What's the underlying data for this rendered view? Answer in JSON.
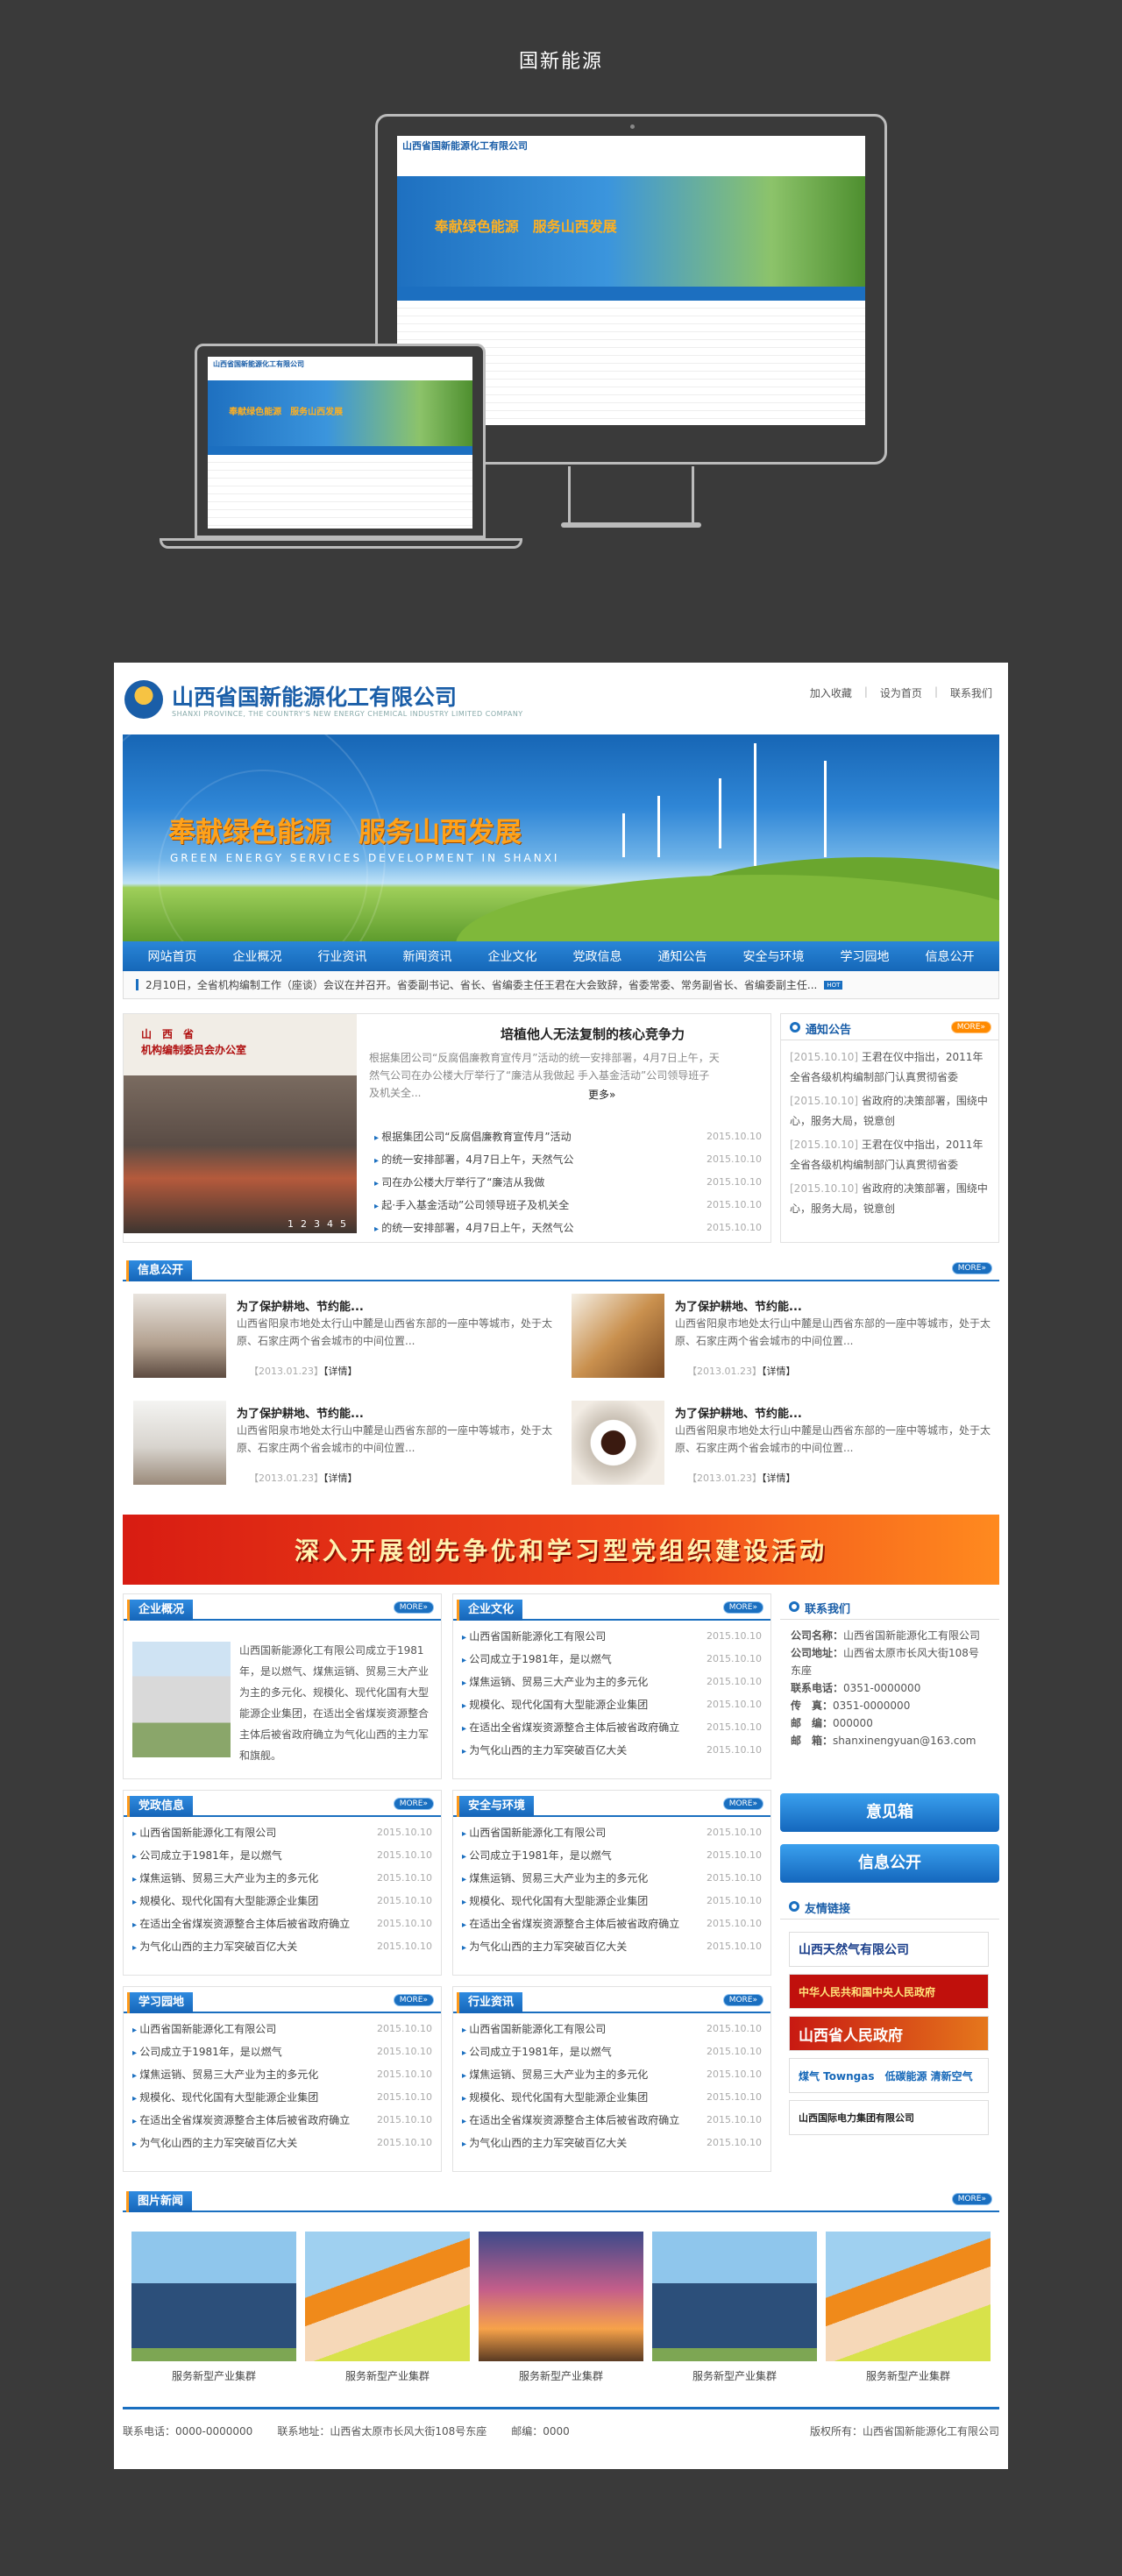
{
  "page_caption": "国新能源",
  "company": {
    "name": "山西省国新能源化工有限公司",
    "name_en": "SHANXI PROVINCE, THE COUNTRY'S NEW ENERGY CHEMICAL INDUSTRY LIMITED COMPANY"
  },
  "top_links": [
    "加入收藏",
    "设为首页",
    "联系我们"
  ],
  "banner": {
    "slogan": "奉献绿色能源　服务山西发展",
    "slogan_en": "GREEN ENERGY SERVICES DEVELOPMENT IN SHANXI"
  },
  "nav": [
    "网站首页",
    "企业概况",
    "行业资讯",
    "新闻资讯",
    "企业文化",
    "党政信息",
    "通知公告",
    "安全与环境",
    "学习园地",
    "信息公开"
  ],
  "ticker": {
    "text": "2月10日，全省机构编制工作（座谈）会议在并召开。省委副书记、省长、省编委主任王君在大会致辞，省委常委、常务副省长、省编委副主任...",
    "hot": "HOT"
  },
  "featured": {
    "title": "培植他人无法复制的核心竞争力",
    "desc": "根据集团公司“反腐倡廉教育宣传月”活动的统一安排部署，4月7日上午，天然气公司在办公楼大厅举行了“廉洁从我做起 手入基金活动”公司领导班子及机关全...",
    "more": "更多»",
    "slide_nums": [
      "1",
      "2",
      "3",
      "4",
      "5"
    ],
    "photo_caption": [
      "山　西　省",
      "机构编制委员会办公室"
    ],
    "list": [
      {
        "text": "根据集团公司“反腐倡廉教育宣传月”活动",
        "date": "2015.10.10"
      },
      {
        "text": "的统一安排部署，4月7日上午，天然气公",
        "date": "2015.10.10"
      },
      {
        "text": "司在办公楼大厅举行了“廉洁从我做",
        "date": "2015.10.10"
      },
      {
        "text": "起·手入基金活动”公司领导班子及机关全",
        "date": "2015.10.10"
      },
      {
        "text": "的统一安排部署，4月7日上午，天然气公",
        "date": "2015.10.10"
      }
    ]
  },
  "notice": {
    "title": "通知公告",
    "more": "MORE»",
    "items": [
      {
        "date": "[2015.10.10]",
        "text": "王君在仪中指出，2011年全省各级机构编制部门认真贯彻省委"
      },
      {
        "date": "[2015.10.10]",
        "text": "省政府的决策部署，围绕中心，服务大局，锐意创"
      },
      {
        "date": "[2015.10.10]",
        "text": "王君在仪中指出，2011年全省各级机构编制部门认真贯彻省委"
      },
      {
        "date": "[2015.10.10]",
        "text": "省政府的决策部署，围绕中心，服务大局，锐意创"
      }
    ]
  },
  "info_open": {
    "title": "信息公开",
    "more": "MORE»",
    "items": [
      {
        "title": "为了保护耕地、节约能...",
        "desc": "山西省阳泉市地处太行山中麓是山西省东部的一座中等城市，处于太原、石家庄两个省会城市的中间位置...",
        "date": "【2013.01.23】",
        "link": "【详情】"
      },
      {
        "title": "为了保护耕地、节约能...",
        "desc": "山西省阳泉市地处太行山中麓是山西省东部的一座中等城市，处于太原、石家庄两个省会城市的中间位置...",
        "date": "【2013.01.23】",
        "link": "【详情】"
      },
      {
        "title": "为了保护耕地、节约能...",
        "desc": "山西省阳泉市地处太行山中麓是山西省东部的一座中等城市，处于太原、石家庄两个省会城市的中间位置...",
        "date": "【2013.01.23】",
        "link": "【详情】"
      },
      {
        "title": "为了保护耕地、节约能...",
        "desc": "山西省阳泉市地处太行山中麓是山西省东部的一座中等城市，处于太原、石家庄两个省会城市的中间位置...",
        "date": "【2013.01.23】",
        "link": "【详情】"
      }
    ]
  },
  "red_banner": "深入开展创先争优和学习型党组织建设活动",
  "company_overview": {
    "title": "企业概况",
    "more": "MORE»",
    "text": "山西国新能源化工有限公司成立于1981年，是以燃气、煤焦运销、贸易三大产业为主的多元化、规模化、现代化国有大型能源企业集团，在适出全省煤炭资源整合主体后被省政府确立为气化山西的主力军和旗舰。"
  },
  "news_lists": {
    "items": [
      {
        "text": "山西省国新能源化工有限公司",
        "date": "2015.10.10"
      },
      {
        "text": "公司成立于1981年，是以燃气",
        "date": "2015.10.10"
      },
      {
        "text": "煤焦运销、贸易三大产业为主的多元化",
        "date": "2015.10.10"
      },
      {
        "text": "规模化、现代化国有大型能源企业集团",
        "date": "2015.10.10"
      },
      {
        "text": "在适出全省煤炭资源整合主体后被省政府确立",
        "date": "2015.10.10"
      },
      {
        "text": "为气化山西的主力军突破百亿大关",
        "date": "2015.10.10"
      }
    ],
    "culture": "企业文化",
    "party": "党政信息",
    "safety": "安全与环境",
    "study": "学习园地",
    "industry": "行业资讯",
    "more": "MORE»"
  },
  "contact": {
    "title": "联系我们",
    "rows": [
      {
        "label": "公司名称：",
        "value": "山西省国新能源化工有限公司"
      },
      {
        "label": "公司地址：",
        "value": "山西省太原市长风大街108号东座"
      },
      {
        "label": "联系电话：",
        "value": "0351-0000000"
      },
      {
        "label": "传　真：",
        "value": "0351-0000000"
      },
      {
        "label": "邮　编：",
        "value": "000000"
      },
      {
        "label": "邮　箱：",
        "value": "shanxinengyuan@163.com"
      }
    ]
  },
  "side_buttons": [
    "意见箱",
    "信息公开"
  ],
  "friend_links": {
    "title": "友情链接",
    "items": [
      "山西天然气有限公司",
      "中华人民共和国中央人民政府",
      "山西省人民政府",
      "煤气 Towngas　低碳能源 清新空气",
      "山西国际电力集团有限公司"
    ]
  },
  "gallery": {
    "title": "图片新闻",
    "more": "MORE»",
    "captions": [
      "服务新型产业集群",
      "服务新型产业集群",
      "服务新型产业集群",
      "服务新型产业集群",
      "服务新型产业集群"
    ]
  },
  "footer": {
    "phone": "联系电话：0000-0000000",
    "address": "联系地址：山西省太原市长风大街108号东座",
    "postcode": "邮编：0000",
    "copyright": "版权所有：山西省国新能源化工有限公司"
  },
  "colors": {
    "primary": "#1a6fc0",
    "accent": "#ff8a00",
    "banner_text": "#ffa21a"
  }
}
